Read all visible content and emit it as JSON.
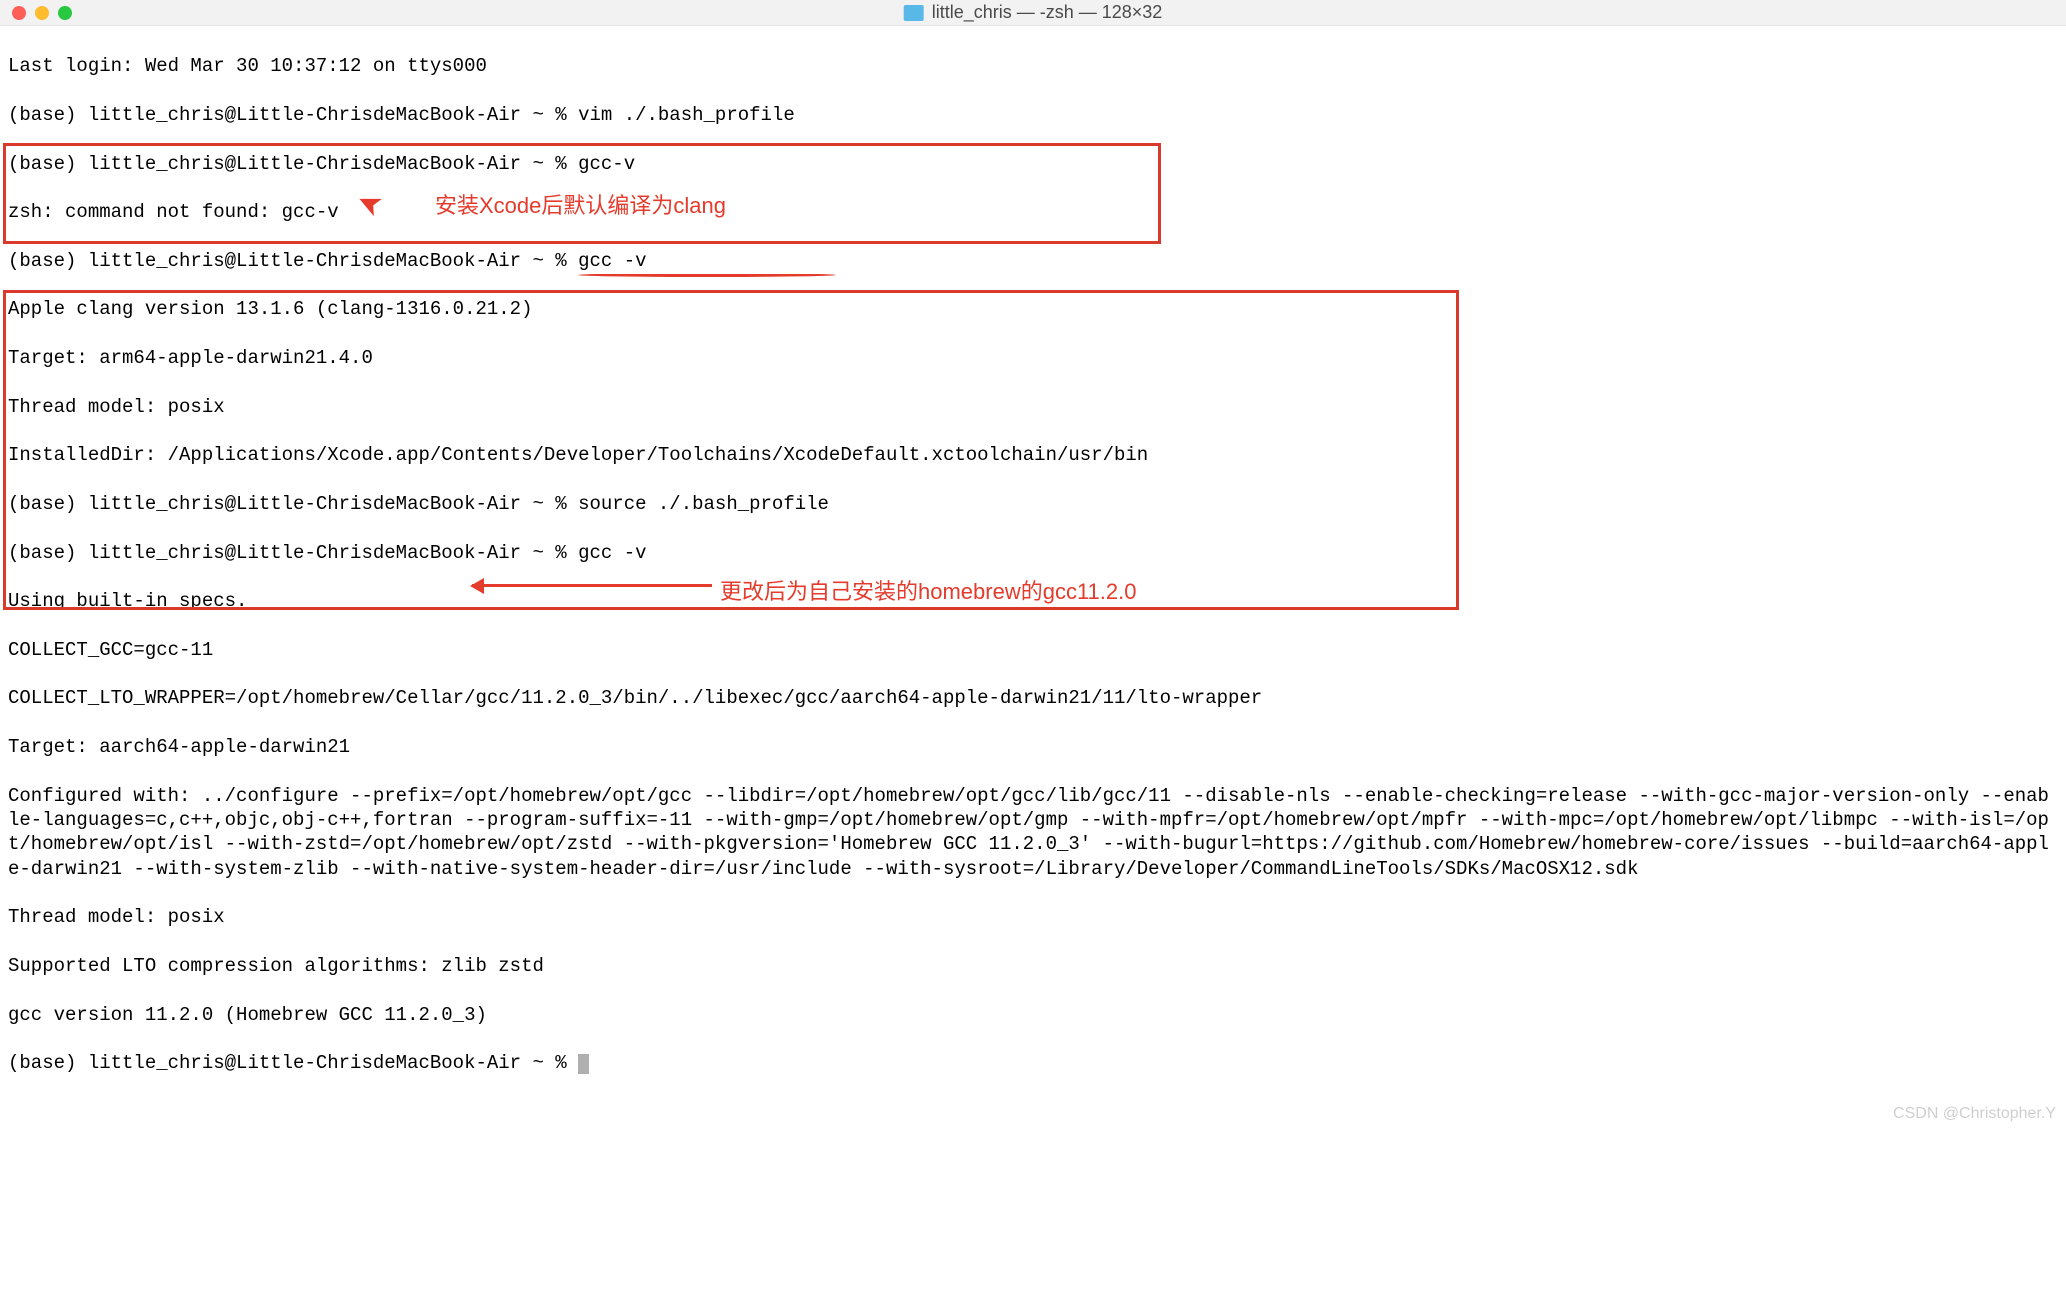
{
  "window": {
    "title": "little_chris — -zsh — 128×32"
  },
  "terminal": {
    "lines": {
      "l0": "Last login: Wed Mar 30 10:37:12 on ttys000",
      "l1": "(base) little_chris@Little-ChrisdeMacBook-Air ~ % vim ./.bash_profile",
      "l2": "(base) little_chris@Little-ChrisdeMacBook-Air ~ % gcc-v",
      "l3": "zsh: command not found: gcc-v",
      "l4": "(base) little_chris@Little-ChrisdeMacBook-Air ~ % gcc -v",
      "l5": "Apple clang version 13.1.6 (clang-1316.0.21.2)",
      "l6": "Target: arm64-apple-darwin21.4.0",
      "l7": "Thread model: posix",
      "l8": "InstalledDir: /Applications/Xcode.app/Contents/Developer/Toolchains/XcodeDefault.xctoolchain/usr/bin",
      "l9": "(base) little_chris@Little-ChrisdeMacBook-Air ~ % source ./.bash_profile",
      "l10": "(base) little_chris@Little-ChrisdeMacBook-Air ~ % gcc -v",
      "l11": "Using built-in specs.",
      "l12": "COLLECT_GCC=gcc-11",
      "l13": "COLLECT_LTO_WRAPPER=/opt/homebrew/Cellar/gcc/11.2.0_3/bin/../libexec/gcc/aarch64-apple-darwin21/11/lto-wrapper",
      "l14": "Target: aarch64-apple-darwin21",
      "l15": "Configured with: ../configure --prefix=/opt/homebrew/opt/gcc --libdir=/opt/homebrew/opt/gcc/lib/gcc/11 --disable-nls --enable-checking=release --with-gcc-major-version-only --enable-languages=c,c++,objc,obj-c++,fortran --program-suffix=-11 --with-gmp=/opt/homebrew/opt/gmp --with-mpfr=/opt/homebrew/opt/mpfr --with-mpc=/opt/homebrew/opt/libmpc --with-isl=/opt/homebrew/opt/isl --with-zstd=/opt/homebrew/opt/zstd --with-pkgversion='Homebrew GCC 11.2.0_3' --with-bugurl=https://github.com/Homebrew/homebrew-core/issues --build=aarch64-apple-darwin21 --with-system-zlib --with-native-system-header-dir=/usr/include --with-sysroot=/Library/Developer/CommandLineTools/SDKs/MacOSX12.sdk",
      "l16": "Thread model: posix",
      "l17": "Supported LTO compression algorithms: zlib zstd",
      "l18": "gcc version 11.2.0 (Homebrew GCC 11.2.0_3)",
      "l19": "(base) little_chris@Little-ChrisdeMacBook-Air ~ % "
    }
  },
  "annotations": {
    "a1": "安装Xcode后默认编译为clang",
    "a2": "更改后为自己安装的homebrew的gcc11.2.0"
  },
  "watermark": "CSDN @Christopher.Y",
  "colors": {
    "annotation": "#e43b2c",
    "box_border": "#d93a2b"
  }
}
